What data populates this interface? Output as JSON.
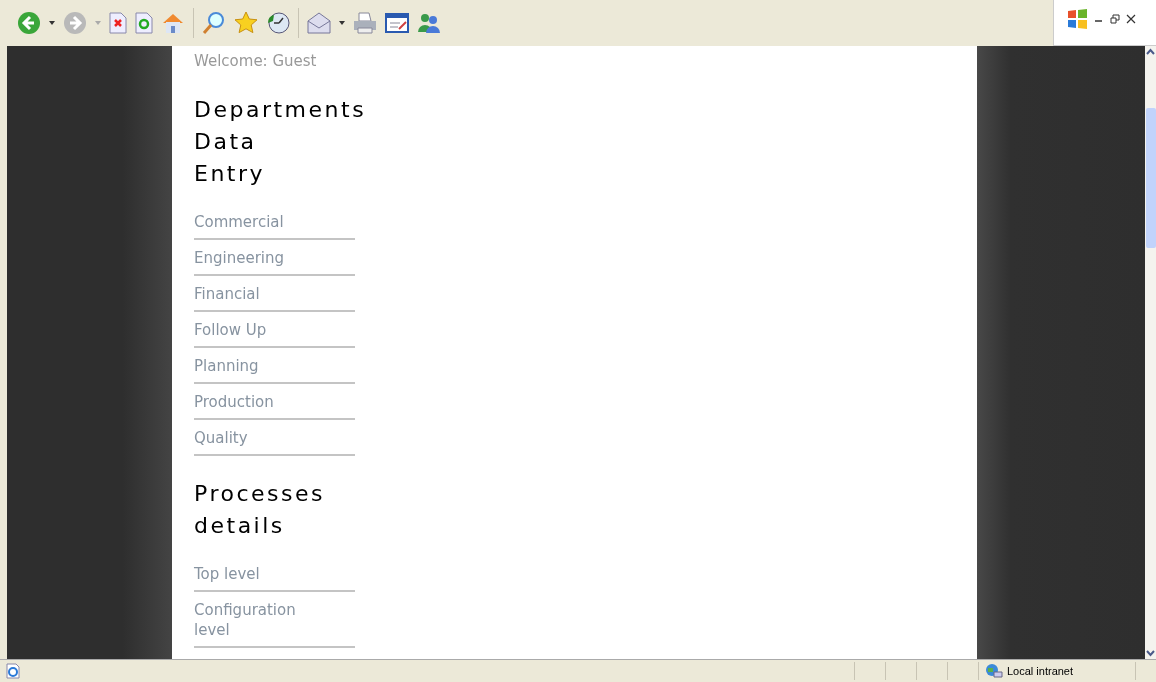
{
  "welcome": "Welcome: Guest",
  "sections": [
    {
      "heading_lines": [
        "Departments",
        "Data",
        "Entry"
      ],
      "links": [
        "Commercial",
        "Engineering",
        "Financial",
        "Follow Up",
        "Planning",
        "Production",
        "Quality"
      ]
    },
    {
      "heading_lines": [
        "Processes",
        "details"
      ],
      "links": [
        "Top level",
        "Configuration level"
      ]
    }
  ],
  "status_bar": {
    "zone": "Local intranet"
  }
}
